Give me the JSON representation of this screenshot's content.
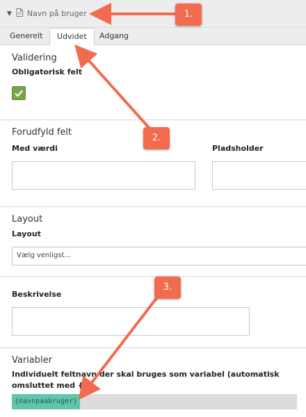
{
  "header": {
    "title": "Navn på bruger",
    "collapse_icon": "triangle-down-icon",
    "type_icon": "document-icon"
  },
  "tabs": [
    {
      "label": "Generelt"
    },
    {
      "label": "Udvidet"
    },
    {
      "label": "Adgang"
    }
  ],
  "active_tab": "Udvidet",
  "validation": {
    "title": "Validering",
    "required_label": "Obligatorisk felt",
    "required_checked": true
  },
  "prefill": {
    "title": "Forudfyld felt",
    "value_label": "Med værdi",
    "placeholder_label": "Pladsholder",
    "value": "",
    "placeholder": ""
  },
  "layout": {
    "title": "Layout",
    "label": "Layout",
    "selected": "Vælg venligst..."
  },
  "description": {
    "label": "Beskrivelse",
    "value": ""
  },
  "variables": {
    "title": "Variabler",
    "description": "Individuelt feltnavn der skal bruges som variabel (automatisk omsluttet med {})",
    "tag": "{navnpaabruger}"
  },
  "annotations": {
    "a1": "1.",
    "a2": "2.",
    "a3": "3."
  },
  "colors": {
    "annotation": "#f26b4e",
    "checkbox": "#79a548",
    "variable_tag": "#5fc6ad"
  }
}
